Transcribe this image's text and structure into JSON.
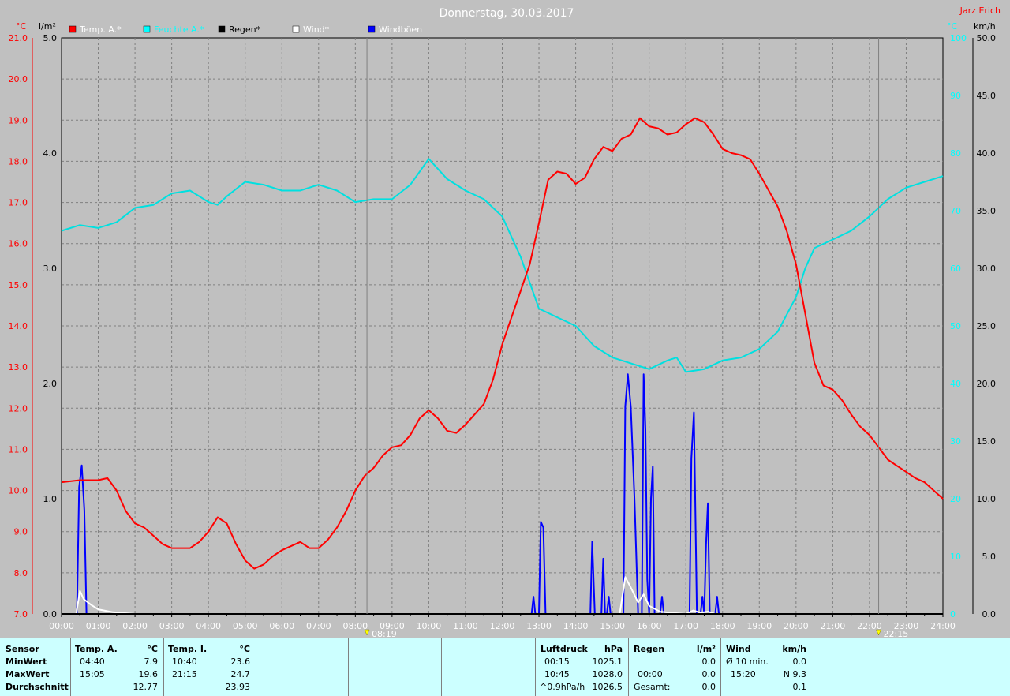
{
  "colors": {
    "background": "#c0c0c0",
    "temp": "#ff0000",
    "dew": "#00e0e0",
    "rain": "#000000",
    "wind": "#ffffff",
    "gust": "#0000ff",
    "grid": "#808080",
    "panel": "#ccffff"
  },
  "header": {
    "title": "Donnerstag, 30.03.2017",
    "author": "Jarz Erich",
    "unit_temp_left": "°C",
    "unit_rain": "l/m²",
    "unit_temp_right": "°C",
    "unit_wind": "km/h"
  },
  "legend": [
    {
      "label": "Temp. A.*",
      "color": "#ff0000",
      "text_color": "#ffffff"
    },
    {
      "label": "Feuchte A.*",
      "color": "#00ffff",
      "text_color": "#00ffff"
    },
    {
      "label": "Regen*",
      "color": "#000000",
      "text_color": "#000000"
    },
    {
      "label": "Wind*",
      "color": "#ffffff",
      "text_color": "#ffffff"
    },
    {
      "label": "Windböen",
      "color": "#0000ff",
      "text_color": "#ffffff"
    }
  ],
  "markers": {
    "sunrise": "08:19",
    "sunset": "22:15"
  },
  "chart_data": {
    "type": "line",
    "title": "Donnerstag, 30.03.2017",
    "xlabel": "",
    "x_ticks": [
      "00:00",
      "01:00",
      "02:00",
      "03:00",
      "04:00",
      "05:00",
      "06:00",
      "07:00",
      "08:00",
      "09:00",
      "10:00",
      "11:00",
      "12:00",
      "13:00",
      "14:00",
      "15:00",
      "16:00",
      "17:00",
      "18:00",
      "19:00",
      "20:00",
      "21:00",
      "22:00",
      "23:00",
      "24:00"
    ],
    "xlim": [
      0,
      24
    ],
    "axes": {
      "temp_left": {
        "label": "°C",
        "range": [
          7.0,
          21.0
        ],
        "ticks": [
          "21.0",
          "20.0",
          "19.0",
          "18.0",
          "17.0",
          "16.0",
          "15.0",
          "14.0",
          "13.0",
          "12.0",
          "11.0",
          "10.0",
          "9.0",
          "8.0",
          "7.0"
        ]
      },
      "rain": {
        "label": "l/m²",
        "range": [
          0.0,
          5.0
        ],
        "ticks": [
          "5.0",
          "4.0",
          "3.0",
          "2.0",
          "1.0",
          "0.0"
        ]
      },
      "temp_right": {
        "label": "°C",
        "range": [
          0,
          100
        ],
        "ticks": [
          "100",
          "90",
          "80",
          "70",
          "60",
          "50",
          "40",
          "30",
          "20",
          "10",
          "0"
        ]
      },
      "wind": {
        "label": "km/h",
        "range": [
          0.0,
          50.0
        ],
        "ticks": [
          "50.0",
          "45.0",
          "40.0",
          "35.0",
          "30.0",
          "25.0",
          "20.0",
          "15.0",
          "10.0",
          "5.0",
          "0.0"
        ]
      }
    },
    "grid": true,
    "legend_position": "top-left",
    "series": [
      {
        "name": "Temp. A.*",
        "axis": "temp_left",
        "color": "#ff0000",
        "points": [
          [
            0,
            10.2
          ],
          [
            0.5,
            10.25
          ],
          [
            1,
            10.25
          ],
          [
            1.25,
            10.3
          ],
          [
            1.5,
            10.0
          ],
          [
            1.75,
            9.5
          ],
          [
            2,
            9.2
          ],
          [
            2.25,
            9.1
          ],
          [
            2.5,
            8.9
          ],
          [
            2.75,
            8.7
          ],
          [
            3,
            8.6
          ],
          [
            3.5,
            8.6
          ],
          [
            3.75,
            8.75
          ],
          [
            4,
            9.0
          ],
          [
            4.25,
            9.35
          ],
          [
            4.5,
            9.2
          ],
          [
            4.75,
            8.7
          ],
          [
            5,
            8.3
          ],
          [
            5.25,
            8.1
          ],
          [
            5.5,
            8.2
          ],
          [
            5.75,
            8.4
          ],
          [
            6,
            8.55
          ],
          [
            6.5,
            8.75
          ],
          [
            6.75,
            8.6
          ],
          [
            7,
            8.6
          ],
          [
            7.25,
            8.8
          ],
          [
            7.5,
            9.1
          ],
          [
            7.75,
            9.5
          ],
          [
            8,
            10.0
          ],
          [
            8.25,
            10.35
          ],
          [
            8.5,
            10.55
          ],
          [
            8.75,
            10.85
          ],
          [
            9,
            11.05
          ],
          [
            9.25,
            11.1
          ],
          [
            9.5,
            11.35
          ],
          [
            9.75,
            11.75
          ],
          [
            10,
            11.95
          ],
          [
            10.25,
            11.75
          ],
          [
            10.5,
            11.45
          ],
          [
            10.75,
            11.4
          ],
          [
            11,
            11.6
          ],
          [
            11.25,
            11.85
          ],
          [
            11.5,
            12.1
          ],
          [
            11.75,
            12.7
          ],
          [
            12,
            13.55
          ],
          [
            12.25,
            14.2
          ],
          [
            12.5,
            14.85
          ],
          [
            12.75,
            15.5
          ],
          [
            13,
            16.5
          ],
          [
            13.25,
            17.55
          ],
          [
            13.5,
            17.75
          ],
          [
            13.75,
            17.7
          ],
          [
            14,
            17.45
          ],
          [
            14.25,
            17.6
          ],
          [
            14.5,
            18.05
          ],
          [
            14.75,
            18.35
          ],
          [
            15,
            18.25
          ],
          [
            15.25,
            18.55
          ],
          [
            15.5,
            18.65
          ],
          [
            15.75,
            19.05
          ],
          [
            16,
            18.85
          ],
          [
            16.25,
            18.8
          ],
          [
            16.5,
            18.65
          ],
          [
            16.75,
            18.7
          ],
          [
            17,
            18.9
          ],
          [
            17.25,
            19.05
          ],
          [
            17.5,
            18.95
          ],
          [
            17.75,
            18.65
          ],
          [
            18,
            18.3
          ],
          [
            18.25,
            18.2
          ],
          [
            18.5,
            18.15
          ],
          [
            18.75,
            18.05
          ],
          [
            19,
            17.7
          ],
          [
            19.25,
            17.3
          ],
          [
            19.5,
            16.9
          ],
          [
            19.75,
            16.3
          ],
          [
            20,
            15.5
          ],
          [
            20.25,
            14.3
          ],
          [
            20.5,
            13.1
          ],
          [
            20.75,
            12.55
          ],
          [
            21,
            12.45
          ],
          [
            21.25,
            12.2
          ],
          [
            21.5,
            11.85
          ],
          [
            21.75,
            11.55
          ],
          [
            22,
            11.35
          ],
          [
            22.25,
            11.05
          ],
          [
            22.5,
            10.75
          ],
          [
            22.75,
            10.6
          ],
          [
            23,
            10.45
          ],
          [
            23.25,
            10.3
          ],
          [
            23.5,
            10.2
          ],
          [
            23.75,
            10.0
          ],
          [
            24,
            9.8
          ]
        ]
      },
      {
        "name": "Feuchte A.*",
        "axis": "temp_right",
        "color": "#00e0e0",
        "points": [
          [
            0,
            66.5
          ],
          [
            0.5,
            67.5
          ],
          [
            1,
            67
          ],
          [
            1.5,
            68
          ],
          [
            2,
            70.5
          ],
          [
            2.5,
            71
          ],
          [
            3,
            73
          ],
          [
            3.5,
            73.5
          ],
          [
            4,
            71.5
          ],
          [
            4.25,
            71
          ],
          [
            4.5,
            72.5
          ],
          [
            5,
            75
          ],
          [
            5.5,
            74.5
          ],
          [
            6,
            73.5
          ],
          [
            6.5,
            73.5
          ],
          [
            7,
            74.5
          ],
          [
            7.5,
            73.5
          ],
          [
            8,
            71.5
          ],
          [
            8.5,
            72
          ],
          [
            9,
            72
          ],
          [
            9.5,
            74.5
          ],
          [
            10,
            79
          ],
          [
            10.5,
            75.5
          ],
          [
            11,
            73.5
          ],
          [
            11.5,
            72
          ],
          [
            12,
            69
          ],
          [
            12.5,
            62
          ],
          [
            13,
            53
          ],
          [
            13.5,
            51.5
          ],
          [
            14,
            50
          ],
          [
            14.5,
            46.5
          ],
          [
            15,
            44.5
          ],
          [
            15.5,
            43.5
          ],
          [
            16,
            42.5
          ],
          [
            16.5,
            44
          ],
          [
            16.75,
            44.5
          ],
          [
            17,
            42
          ],
          [
            17.5,
            42.5
          ],
          [
            18,
            44
          ],
          [
            18.5,
            44.5
          ],
          [
            19,
            46
          ],
          [
            19.5,
            49
          ],
          [
            20,
            55
          ],
          [
            20.25,
            60
          ],
          [
            20.5,
            63.5
          ],
          [
            21,
            65
          ],
          [
            21.5,
            66.5
          ],
          [
            22,
            69
          ],
          [
            22.5,
            72
          ],
          [
            23,
            74
          ],
          [
            23.5,
            75
          ],
          [
            24,
            76
          ]
        ]
      },
      {
        "name": "Regen*",
        "axis": "rain",
        "color": "#000000",
        "points": [
          [
            0,
            0
          ],
          [
            24,
            0
          ]
        ]
      },
      {
        "name": "Wind*",
        "axis": "wind",
        "color": "#ffffff",
        "points": [
          [
            0.4,
            0
          ],
          [
            0.5,
            2
          ],
          [
            0.6,
            1.3
          ],
          [
            0.8,
            0.8
          ],
          [
            1.0,
            0.4
          ],
          [
            1.4,
            0.15
          ],
          [
            2,
            0
          ],
          [
            15.2,
            0
          ],
          [
            15.35,
            3.2
          ],
          [
            15.5,
            2.3
          ],
          [
            15.7,
            1
          ],
          [
            15.85,
            1.7
          ],
          [
            16.0,
            0.7
          ],
          [
            16.3,
            0.2
          ],
          [
            16.6,
            0.1
          ],
          [
            17.0,
            0
          ],
          [
            17.2,
            0.3
          ],
          [
            17.4,
            0.1
          ],
          [
            17.6,
            0.2
          ],
          [
            17.8,
            0
          ]
        ]
      },
      {
        "name": "Windböen",
        "axis": "wind",
        "color": "#0000ff",
        "points": [
          [
            0.42,
            0
          ],
          [
            0.48,
            11
          ],
          [
            0.55,
            12.9
          ],
          [
            0.62,
            9
          ],
          [
            0.68,
            0
          ],
          [
            12.8,
            0
          ],
          [
            12.85,
            1.5
          ],
          [
            12.9,
            0
          ],
          [
            13,
            0
          ],
          [
            13.05,
            8
          ],
          [
            13.12,
            7.5
          ],
          [
            13.18,
            0
          ],
          [
            14.4,
            0
          ],
          [
            14.45,
            6.3
          ],
          [
            14.52,
            0
          ],
          [
            14.7,
            0
          ],
          [
            14.75,
            4.8
          ],
          [
            14.8,
            0
          ],
          [
            14.85,
            0
          ],
          [
            14.9,
            1.5
          ],
          [
            14.95,
            0
          ],
          [
            15.3,
            0
          ],
          [
            15.35,
            18
          ],
          [
            15.42,
            20.8
          ],
          [
            15.5,
            18
          ],
          [
            15.6,
            10
          ],
          [
            15.7,
            0
          ],
          [
            15.8,
            0
          ],
          [
            15.85,
            20.8
          ],
          [
            15.9,
            16
          ],
          [
            15.95,
            3
          ],
          [
            16.0,
            0
          ],
          [
            16.05,
            10
          ],
          [
            16.1,
            12.8
          ],
          [
            16.15,
            0
          ],
          [
            16.3,
            0
          ],
          [
            16.35,
            1.5
          ],
          [
            16.4,
            0
          ],
          [
            17.1,
            0
          ],
          [
            17.15,
            13.5
          ],
          [
            17.22,
            17.5
          ],
          [
            17.3,
            0
          ],
          [
            17.4,
            0
          ],
          [
            17.45,
            1.5
          ],
          [
            17.5,
            0
          ],
          [
            17.55,
            6
          ],
          [
            17.6,
            9.6
          ],
          [
            17.65,
            0
          ],
          [
            17.8,
            0
          ],
          [
            17.85,
            1.5
          ],
          [
            17.9,
            0
          ]
        ]
      }
    ]
  },
  "stats_panel": {
    "sensor_col": {
      "header": "Sensor",
      "rows": [
        "MinWert",
        "MaxWert",
        "Durchschnitt"
      ]
    },
    "temp_a": {
      "header": "Temp. A.",
      "unit": "°C",
      "min_time": "04:40",
      "min_value": "7.9",
      "max_time": "15:05",
      "max_value": "19.6",
      "avg_value": "12.77"
    },
    "temp_i": {
      "header": "Temp. I.",
      "unit": "°C",
      "min_time": "10:40",
      "min_value": "23.6",
      "max_time": "21:15",
      "max_value": "24.7",
      "avg_value": "23.93"
    },
    "pressure": {
      "header": "Luftdruck",
      "unit": "hPa",
      "min_time": "00:15",
      "min_value": "1025.1",
      "max_time": "10:45",
      "max_value": "1028.0",
      "trend_label": "^0.9hPa/h",
      "trend_value": "1026.5"
    },
    "rain": {
      "header": "Regen",
      "unit": "l/m²",
      "row2_time": "00:00",
      "row2_value": "0.0",
      "row1_value": "0.0",
      "total_label": "Gesamt:",
      "total_value": "0.0"
    },
    "wind": {
      "header": "Wind",
      "unit": "km/h",
      "row1_label": "Ø 10 min.",
      "row1_value": "0.0",
      "row2_time": "15:20",
      "row2_value": "N 9.3",
      "row3_value": "0.1"
    }
  }
}
